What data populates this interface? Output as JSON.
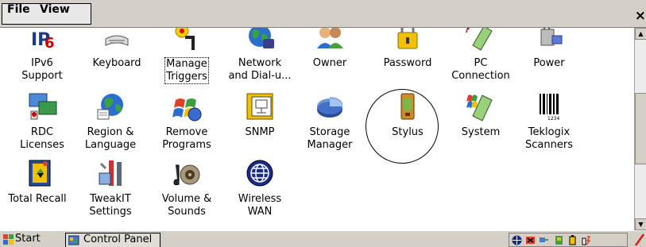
{
  "menubar": {
    "file_label": "File",
    "view_label": "View",
    "close_label": "×"
  },
  "items": [
    {
      "label1": "IPv6",
      "label2": "Support",
      "icon": "ipv6-icon"
    },
    {
      "label1": "Keyboard",
      "label2": "",
      "icon": "keyboard-icon"
    },
    {
      "label1": "Manage",
      "label2": "Triggers",
      "icon": "manage-triggers-icon"
    },
    {
      "label1": "Network",
      "label2": "and Dial-u...",
      "icon": "network-icon"
    },
    {
      "label1": "Owner",
      "label2": "",
      "icon": "owner-icon"
    },
    {
      "label1": "Password",
      "label2": "",
      "icon": "password-icon"
    },
    {
      "label1": "PC",
      "label2": "Connection",
      "icon": "pc-connection-icon"
    },
    {
      "label1": "Power",
      "label2": "",
      "icon": "power-icon"
    },
    {
      "label1": "RDC",
      "label2": "Licenses",
      "icon": "rdc-licenses-icon"
    },
    {
      "label1": "Region &",
      "label2": "Language",
      "icon": "region-language-icon"
    },
    {
      "label1": "Remove",
      "label2": "Programs",
      "icon": "remove-programs-icon"
    },
    {
      "label1": "SNMP",
      "label2": "",
      "icon": "snmp-icon"
    },
    {
      "label1": "Storage",
      "label2": "Manager",
      "icon": "storage-manager-icon"
    },
    {
      "label1": "Stylus",
      "label2": "",
      "icon": "stylus-icon"
    },
    {
      "label1": "System",
      "label2": "",
      "icon": "system-icon"
    },
    {
      "label1": "Teklogix",
      "label2": "Scanners",
      "icon": "teklogix-scanners-icon"
    },
    {
      "label1": "Total Recall",
      "label2": "",
      "icon": "total-recall-icon"
    },
    {
      "label1": "TweakIT",
      "label2": "Settings",
      "icon": "tweakit-icon"
    },
    {
      "label1": "Volume &",
      "label2": "Sounds",
      "icon": "volume-sounds-icon"
    },
    {
      "label1": "Wireless",
      "label2": "WAN",
      "icon": "wireless-wan-icon"
    }
  ],
  "taskbar": {
    "start_label": "Start",
    "task_label": "Control Panel"
  }
}
